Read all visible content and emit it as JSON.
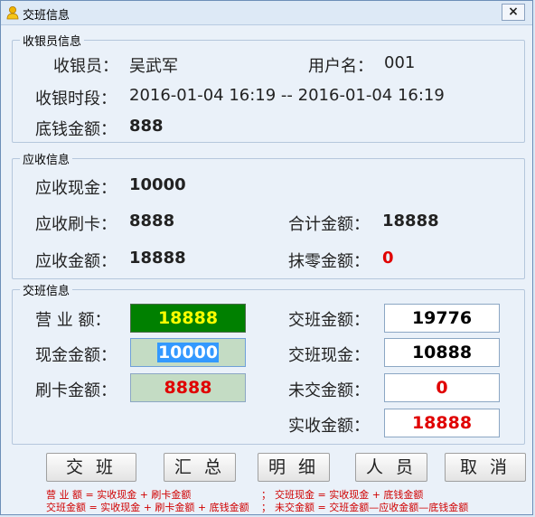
{
  "window": {
    "title": "交班信息",
    "close_glyph": "×"
  },
  "cashier_group": {
    "title": "收银员信息",
    "cashier_label": "收银员：",
    "cashier_value": "吴武军",
    "username_label": "用户名：",
    "username_value": "001",
    "period_label": "收银时段：",
    "period_value": "2016-01-04 16:19 -- 2016-01-04 16:19",
    "float_label": "底钱金额：",
    "float_value": "888"
  },
  "receivable_group": {
    "title": "应收信息",
    "cash_label": "应收现金：",
    "cash_value": "10000",
    "card_label": "应收刷卡：",
    "card_value": "8888",
    "total_label": "合计金额：",
    "total_value": "18888",
    "due_label": "应收金额：",
    "due_value": "18888",
    "rounding_label": "抹零金额：",
    "rounding_value": "0"
  },
  "handover_group": {
    "title": "交班信息",
    "revenue_label": "营 业 额：",
    "revenue_value": "18888",
    "cash_amount_label": "现金金额：",
    "cash_amount_value": "10000",
    "card_amount_label": "刷卡金额：",
    "card_amount_value": "8888",
    "handover_amount_label": "交班金额：",
    "handover_amount_value": "19776",
    "handover_cash_label": "交班现金：",
    "handover_cash_value": "10888",
    "unsubmitted_label": "未交金额：",
    "unsubmitted_value": "0",
    "received_label": "实收金额：",
    "received_value": "18888"
  },
  "buttons": {
    "handover": "交 班",
    "summary": "汇 总",
    "detail": "明 细",
    "staff": "人 员",
    "cancel": "取 消"
  },
  "footnotes": {
    "line1a": "营 业 额 = 实收现金 + 刷卡金额",
    "sep1": "；",
    "line1b": "交班现金 = 实收现金 + 底钱金额",
    "line2a": "交班金额 = 实收现金 + 刷卡金额 + 底钱金额",
    "sep2": "；",
    "line2b": "未交金额 = 交班金额—应收金额—底钱金额"
  },
  "colors": {
    "revenue_bg": "#008000",
    "revenue_text": "#ffff00",
    "cash_bg": "#c4dcc4",
    "card_bg": "#c4dcc4",
    "red": "#e00000",
    "selection": "#3399ff"
  }
}
